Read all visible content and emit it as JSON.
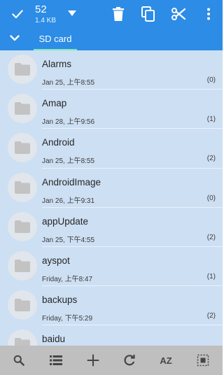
{
  "header": {
    "selected_count": "52",
    "selected_size": "1.4 KB",
    "icons": [
      "check-icon",
      "dropdown-arrow-icon",
      "trash-icon",
      "copy-icon",
      "scissors-icon",
      "more-vert-icon"
    ]
  },
  "path_bar": {
    "current": "SD card"
  },
  "files": [
    {
      "name": "Alarms",
      "date": "Jan 25, 上午8:55",
      "count": "(0)"
    },
    {
      "name": "Amap",
      "date": "Jan 28, 上午9:56",
      "count": "(1)"
    },
    {
      "name": "Android",
      "date": "Jan 25, 上午8:55",
      "count": "(2)"
    },
    {
      "name": "AndroidImage",
      "date": "Jan 26, 上午9:31",
      "count": "(0)"
    },
    {
      "name": "appUpdate",
      "date": "Jan 25, 下午4:55",
      "count": "(2)"
    },
    {
      "name": "ayspot",
      "date": "Friday, 上午8:47",
      "count": "(1)"
    },
    {
      "name": "backups",
      "date": "Friday, 下午5:29",
      "count": "(2)"
    },
    {
      "name": "baidu",
      "date": "",
      "count": ""
    }
  ],
  "bottom_bar": {
    "sort_label": "AZ",
    "icons": [
      "search-icon",
      "list-view-icon",
      "add-icon",
      "refresh-icon",
      "sort-az-icon",
      "select-all-icon"
    ]
  },
  "colors": {
    "accent": "#2c8ce6",
    "list_bg": "#cddff3",
    "tab_underline": "#83e6bd",
    "bottom_bar": "#bfbfbf"
  }
}
